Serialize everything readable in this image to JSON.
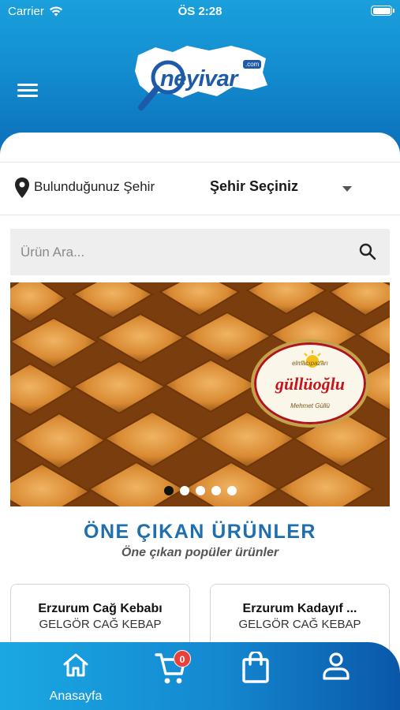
{
  "status_bar": {
    "carrier": "Carrier",
    "time": "ÖS 2:28"
  },
  "header": {
    "logo_text": "neyivar",
    "logo_suffix": ".com"
  },
  "city": {
    "label": "Bulunduğunuz Şehir",
    "select_value": "Şehir Seçiniz"
  },
  "search": {
    "placeholder": "Ürün Ara..."
  },
  "banner": {
    "brand_top": "elmacıpazarı",
    "brand_name": "güllüoğlu",
    "brand_signature": "Mehmet Güllü",
    "slide_count": 5,
    "active_slide": 1
  },
  "featured": {
    "title": "ÖNE ÇIKAN ÜRÜNLER",
    "subtitle": "Öne çıkan popüler ürünler",
    "products": [
      {
        "name": "Erzurum Cağ Kebabı",
        "shop": "GELGÖR CAĞ KEBAP"
      },
      {
        "name": "Erzurum Kadayıf ...",
        "shop": "GELGÖR CAĞ KEBAP"
      }
    ]
  },
  "tabbar": {
    "home_label": "Anasayfa",
    "cart_count": "0",
    "icons": [
      "home-icon",
      "cart-icon",
      "bag-icon",
      "profile-icon"
    ]
  },
  "colors": {
    "header_blue": "#138cd0",
    "title_blue": "#1f6fae",
    "badge_red": "#e8403a"
  }
}
